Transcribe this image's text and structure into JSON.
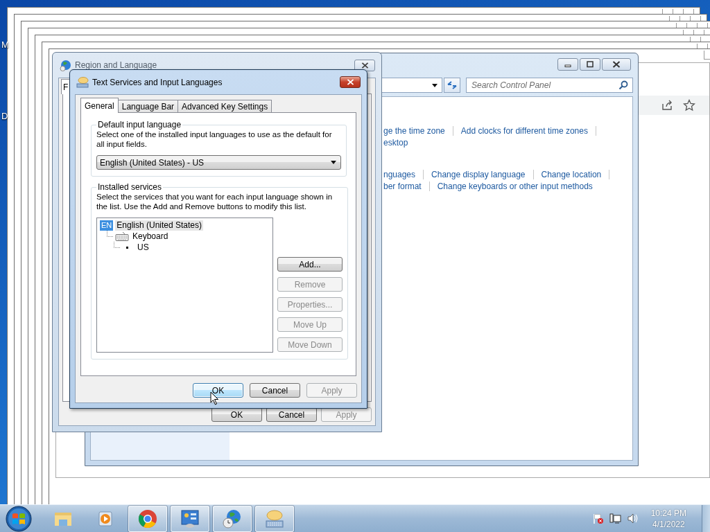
{
  "desktop": {
    "labels": [
      "M",
      "D"
    ]
  },
  "control_panel": {
    "search": {
      "placeholder": "Search Control Panel"
    },
    "sections": [
      {
        "rows": [
          {
            "links": [
              "ge the time zone",
              "Add clocks for different time zones"
            ],
            "trailing_separator": true
          },
          {
            "links": [
              "esktop"
            ],
            "trailing_separator": false
          }
        ]
      },
      {
        "rows": [
          {
            "links": [
              "nguages",
              "Change display language",
              "Change location"
            ],
            "trailing_separator": true
          },
          {
            "links": [
              "ber format",
              "Change keyboards or other input methods"
            ],
            "trailing_separator": false
          }
        ]
      }
    ]
  },
  "region_dialog": {
    "title": "Region and Language",
    "tabs": [
      {
        "label": "F",
        "selected": true
      }
    ],
    "buttons": [
      {
        "label": "OK",
        "disabled": false
      },
      {
        "label": "Cancel",
        "disabled": false
      },
      {
        "label": "Apply",
        "disabled": true
      }
    ]
  },
  "text_services_dialog": {
    "title": "Text Services and Input Languages",
    "tabs": [
      {
        "label": "General",
        "selected": true
      },
      {
        "label": "Language Bar",
        "selected": false
      },
      {
        "label": "Advanced Key Settings",
        "selected": false
      }
    ],
    "default_input_language": {
      "title": "Default input language",
      "description": "Select one of the installed input languages to use as the default for all input fields.",
      "value": "English (United States) - US"
    },
    "installed_services": {
      "title": "Installed services",
      "description": "Select the services that you want for each input language shown in the list. Use the Add and Remove buttons to modify this list.",
      "tree": [
        {
          "kind": "language",
          "badge": "EN",
          "label": "English (United States)",
          "selected": true,
          "children": [
            {
              "kind": "category",
              "label": "Keyboard",
              "selected": false,
              "children": [
                {
                  "kind": "layout",
                  "label": "US",
                  "selected": false
                }
              ]
            }
          ]
        }
      ],
      "buttons": [
        {
          "label": "Add...",
          "disabled": false
        },
        {
          "label": "Remove",
          "disabled": true
        },
        {
          "label": "Properties...",
          "disabled": true
        },
        {
          "label": "Move Up",
          "disabled": true
        },
        {
          "label": "Move Down",
          "disabled": true
        }
      ]
    },
    "buttons": [
      {
        "label": "OK",
        "disabled": false,
        "focused": true
      },
      {
        "label": "Cancel",
        "disabled": false,
        "focused": false
      },
      {
        "label": "Apply",
        "disabled": true,
        "focused": false
      }
    ]
  },
  "taskbar": {
    "items": [
      {
        "kind": "explorer",
        "open": false
      },
      {
        "kind": "media-player",
        "open": false
      },
      {
        "kind": "browser",
        "open": true
      },
      {
        "kind": "control-panel",
        "open": true
      },
      {
        "kind": "region",
        "open": true
      },
      {
        "kind": "keyboard",
        "open": true
      }
    ],
    "clock": {
      "time": "10:24 PM",
      "date": "4/1/2022"
    }
  }
}
